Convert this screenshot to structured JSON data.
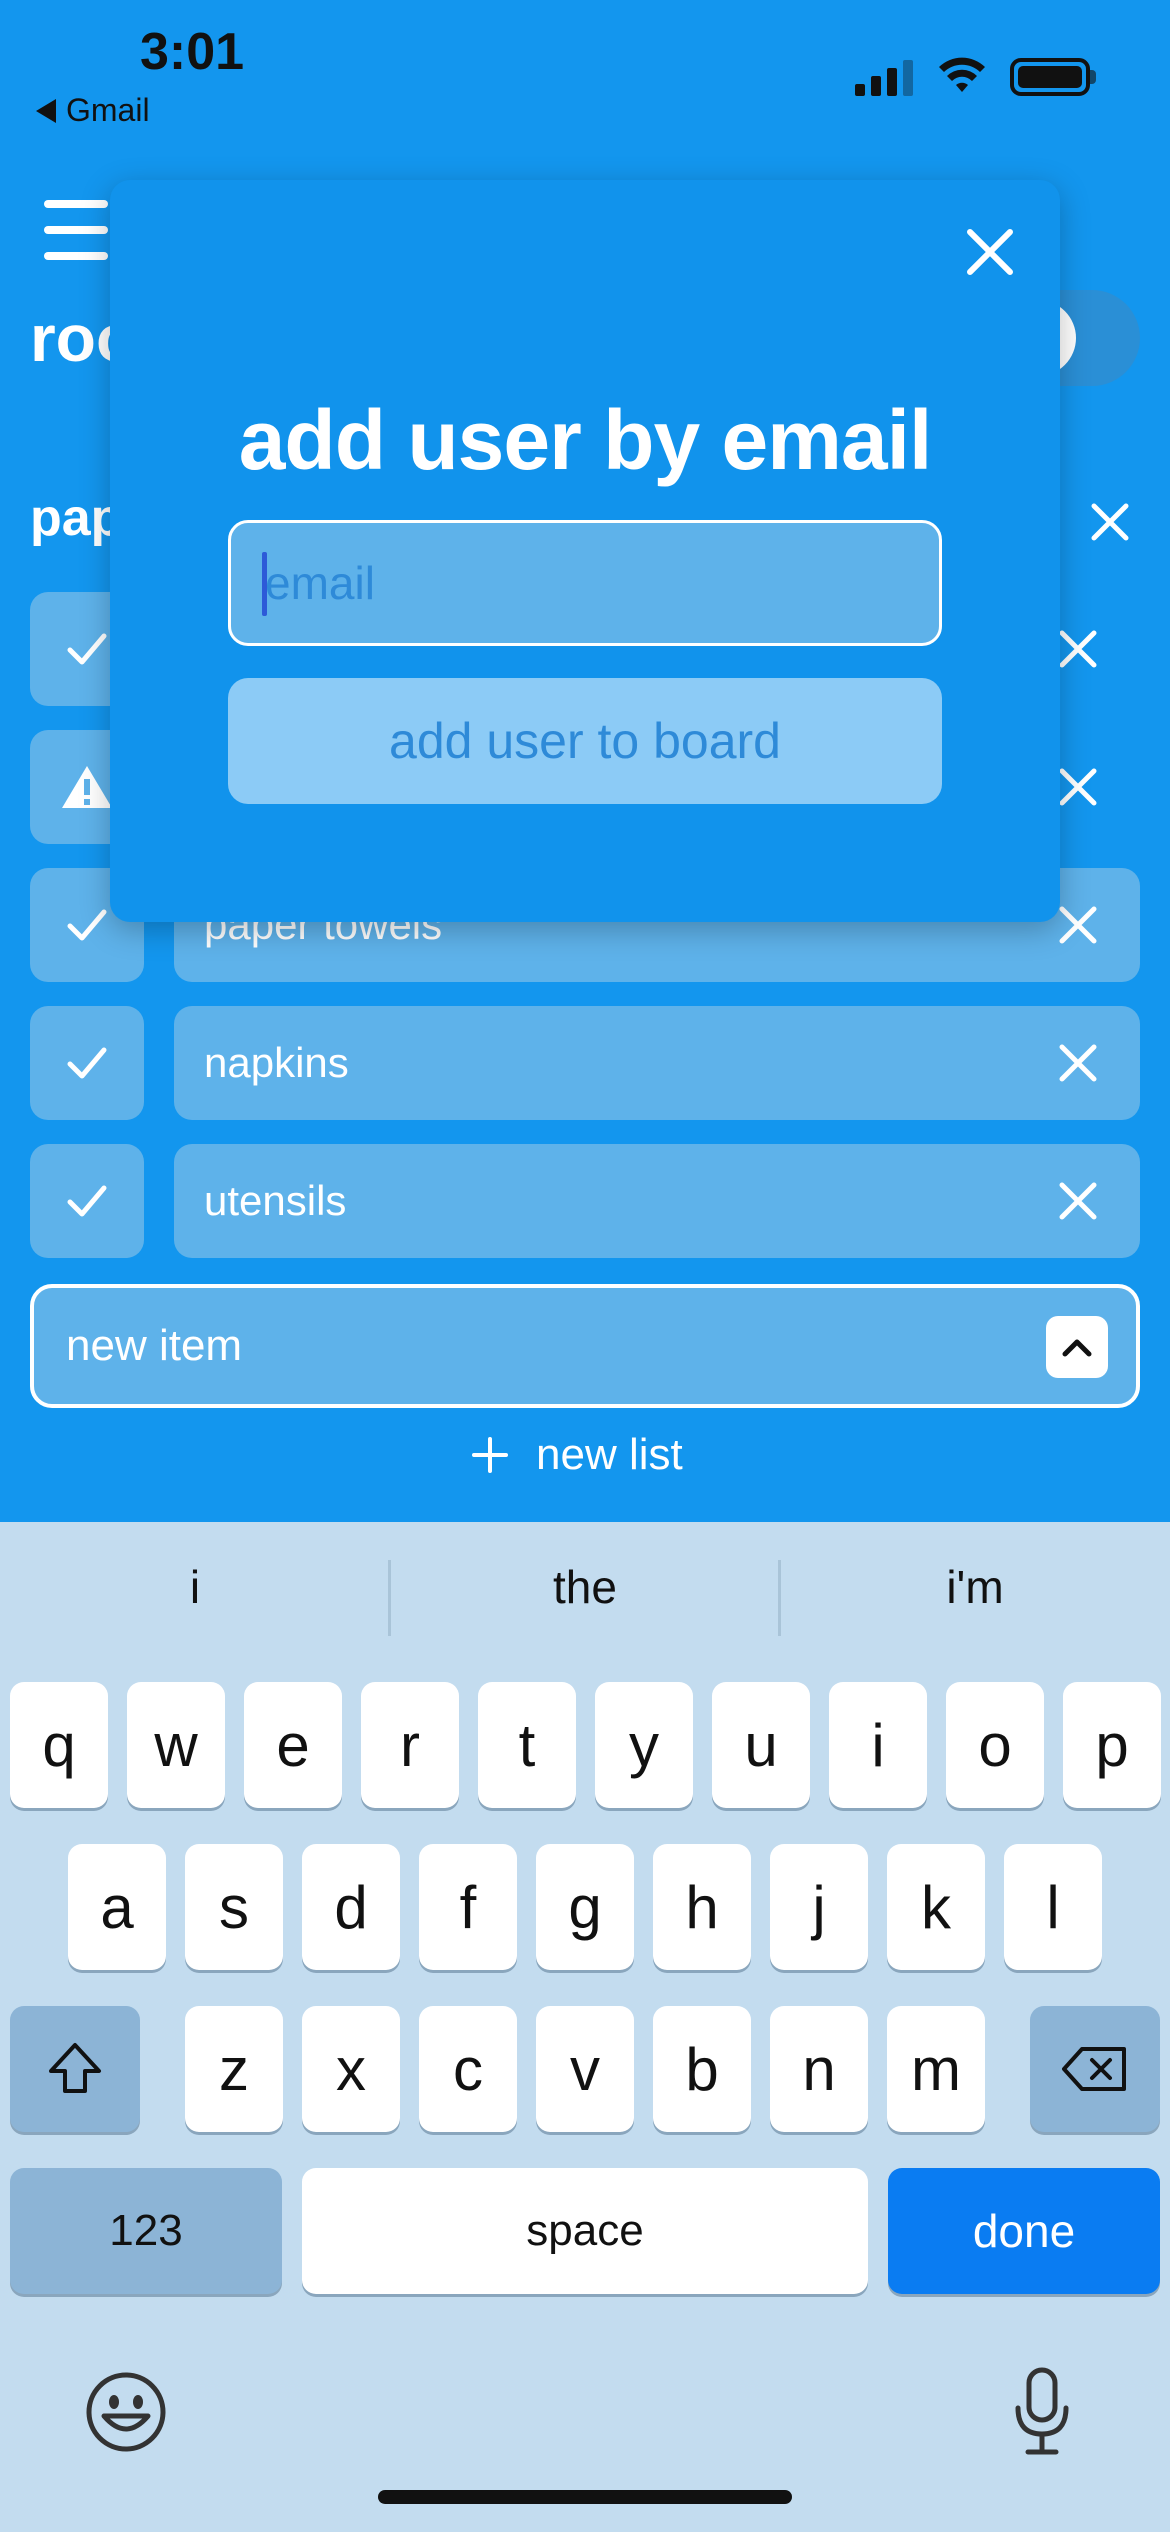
{
  "status_bar": {
    "time": "3:01",
    "back_app": "Gmail"
  },
  "board": {
    "title": "roo"
  },
  "list": {
    "title": "pap",
    "items": [
      {
        "status": "check",
        "label": ""
      },
      {
        "status": "warning",
        "label": ""
      },
      {
        "status": "check",
        "label": "paper towels"
      },
      {
        "status": "check",
        "label": "napkins"
      },
      {
        "status": "check",
        "label": "utensils"
      }
    ]
  },
  "new_item": {
    "placeholder": "new item"
  },
  "new_list": {
    "label": "new list"
  },
  "modal": {
    "title": "add user by email",
    "email_placeholder": "email",
    "email_value": "",
    "submit_label": "add user to board"
  },
  "keyboard": {
    "suggestions": [
      "i",
      "the",
      "i'm"
    ],
    "row1": [
      "q",
      "w",
      "e",
      "r",
      "t",
      "y",
      "u",
      "i",
      "o",
      "p"
    ],
    "row2": [
      "a",
      "s",
      "d",
      "f",
      "g",
      "h",
      "j",
      "k",
      "l"
    ],
    "row3": [
      "z",
      "x",
      "c",
      "v",
      "b",
      "n",
      "m"
    ],
    "numbers_label": "123",
    "space_label": "space",
    "done_label": "done"
  },
  "colors": {
    "background": "#1396ee",
    "modal": "#1193ec",
    "done_key": "#0a7cf2",
    "keyboard": "#c3dcef"
  }
}
